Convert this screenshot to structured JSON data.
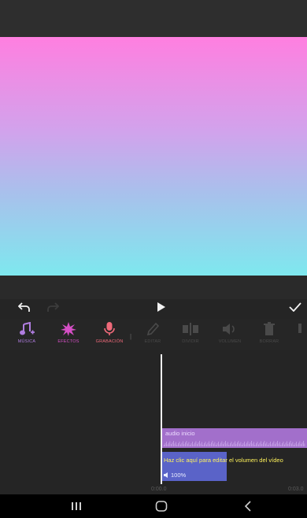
{
  "toolbar": {
    "items": [
      {
        "label": "MÚSICA",
        "icon": "music-note-plus-icon",
        "color": "#b07de0"
      },
      {
        "label": "EFECTOS",
        "icon": "sparkle-burst-icon",
        "color": "#d64fc6"
      },
      {
        "label": "GRABACIÓN",
        "icon": "microphone-icon",
        "color": "#f06a7a"
      },
      {
        "label": "EDITAR",
        "icon": "pencil-icon"
      },
      {
        "label": "DIVIDIR",
        "icon": "split-icon"
      },
      {
        "label": "VOLUMEN",
        "icon": "speaker-icon"
      },
      {
        "label": "BORRAR",
        "icon": "trash-icon"
      }
    ]
  },
  "timeline": {
    "audio_clip_label": "audio inicio",
    "video_hint": "Haz clic aquí para editar el volumen del vídeo",
    "volume_label": "100%",
    "time_start": "0:00.0",
    "time_end": "0:03.0"
  },
  "colors": {
    "audio_clip": "#a26fcb",
    "video_clip": "#5a63c8",
    "hint_text": "#fff25a",
    "gradient_top": "#ff7fe0",
    "gradient_bottom": "#7ee8ee"
  }
}
